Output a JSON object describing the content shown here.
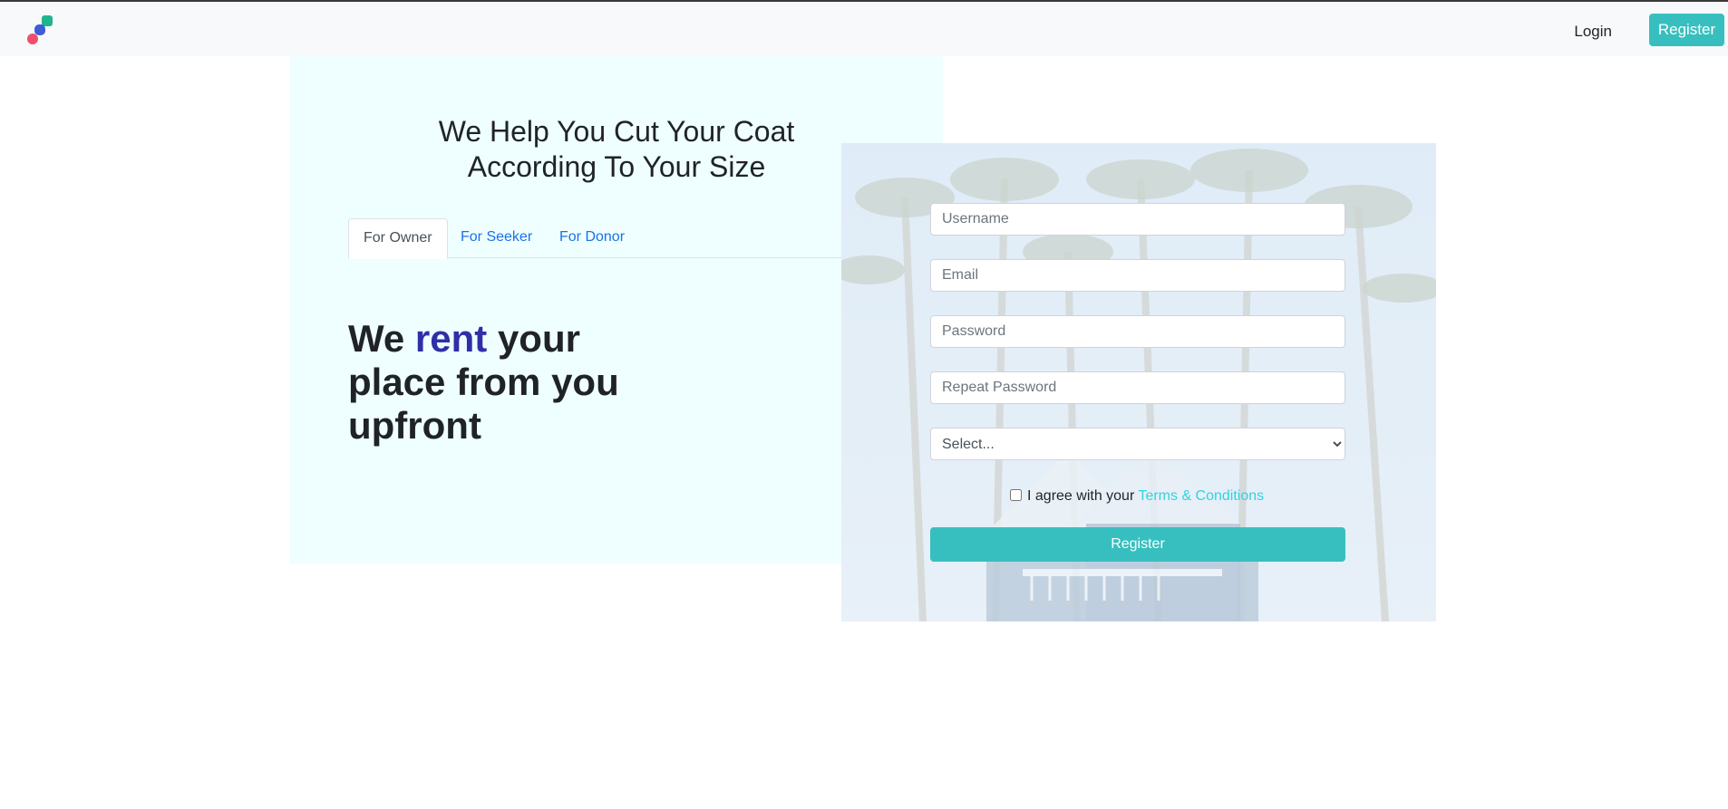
{
  "nav": {
    "login_label": "Login",
    "register_label": "Register"
  },
  "hero": {
    "headline_line1": "We Help You Cut Your Coat",
    "headline_line2": "According To Your Size",
    "tabs": [
      {
        "label": "For Owner",
        "active": true
      },
      {
        "label": "For Seeker",
        "active": false
      },
      {
        "label": "For Donor",
        "active": false
      }
    ],
    "tagline": {
      "part1": "We ",
      "accent": "rent",
      "part2": " your place from you upfront"
    }
  },
  "form": {
    "username_placeholder": "Username",
    "email_placeholder": "Email",
    "password_placeholder": "Password",
    "repeat_password_placeholder": "Repeat Password",
    "select_value": "Select...",
    "agree_text": "I agree with your ",
    "terms_link": "Terms & Conditions",
    "submit_label": "Register"
  },
  "colors": {
    "brand_teal": "#37bfbf",
    "hero_bg": "#effefe",
    "tab_link": "#1a73e8",
    "accent_word": "#2f2fa8",
    "terms_link": "#2fd3e0"
  }
}
